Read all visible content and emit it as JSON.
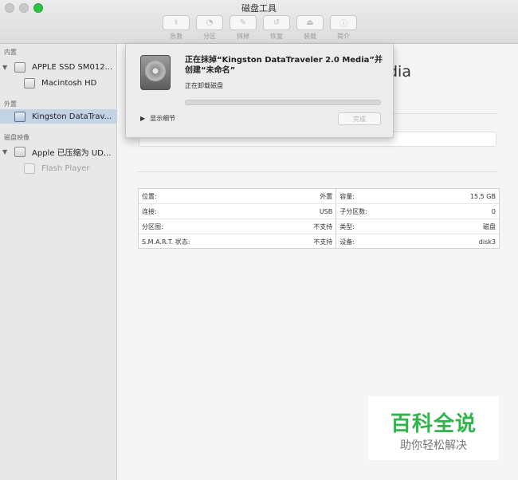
{
  "window": {
    "title": "磁盘工具"
  },
  "toolbar": {
    "buttons": [
      {
        "label": "急救",
        "icon": "stethoscope-icon",
        "glyph": "⚕"
      },
      {
        "label": "分区",
        "icon": "partition-icon",
        "glyph": "◔"
      },
      {
        "label": "抹掉",
        "icon": "erase-icon",
        "glyph": "✎"
      },
      {
        "label": "恢复",
        "icon": "restore-icon",
        "glyph": "↺"
      },
      {
        "label": "装载",
        "icon": "mount-icon",
        "glyph": "⏏"
      },
      {
        "label": "简介",
        "icon": "info-icon",
        "glyph": "ⓘ"
      }
    ]
  },
  "sidebar": {
    "sections": {
      "internal": "内置",
      "external": "外置",
      "images": "磁盘映像"
    },
    "items": [
      {
        "label": "APPLE SSD SM012..."
      },
      {
        "label": "Macintosh HD"
      },
      {
        "label": "Kingston DataTrav..."
      },
      {
        "label": "Apple 已压缩为 UD..."
      },
      {
        "label": "Flash Player"
      }
    ]
  },
  "main": {
    "title_partial": "dia",
    "info": {
      "rows": [
        {
          "k1": "位置:",
          "v1": "外置",
          "k2": "容量:",
          "v2": "15.5 GB"
        },
        {
          "k1": "连接:",
          "v1": "USB",
          "k2": "子分区数:",
          "v2": "0"
        },
        {
          "k1": "分区图:",
          "v1": "不支持",
          "k2": "类型:",
          "v2": "磁盘"
        },
        {
          "k1": "S.M.A.R.T. 状态:",
          "v1": "不支持",
          "k2": "设备:",
          "v2": "disk3"
        }
      ]
    }
  },
  "sheet": {
    "message": "正在抹掉“Kingston DataTraveler 2.0 Media”并创建“未命名”",
    "status": "正在卸载磁盘",
    "progress": 0,
    "details_label": "显示细节",
    "done_label": "完成"
  },
  "watermark": {
    "line1": "百科全说",
    "line2": "助你轻松解决"
  }
}
